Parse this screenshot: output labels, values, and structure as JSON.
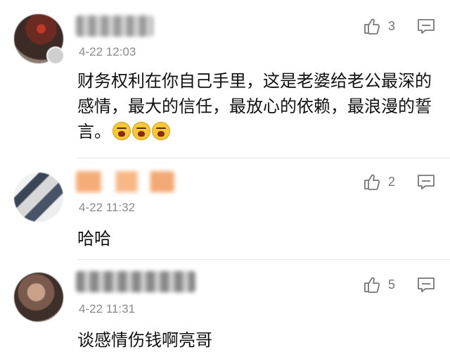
{
  "comments": [
    {
      "time": "4-22 12:03",
      "likes": "3",
      "text": "财务权利在你自己手里，这是老婆给老公最深的感情，最大的信任，最放心的依赖，最浪漫的誓言。",
      "emoji_count": 3,
      "emoji_icon": "angry-face-icon"
    },
    {
      "time": "4-22 11:32",
      "likes": "2",
      "text": "哈哈"
    },
    {
      "time": "4-22 11:31",
      "likes": "5",
      "text": "谈感情伤钱啊亮哥"
    }
  ],
  "icons": {
    "like": "thumbs-up-icon",
    "reply": "comment-icon"
  },
  "colors": {
    "meta_text": "#8a8a8a",
    "icon_stroke": "#777777",
    "divider": "#e6e6e6"
  }
}
